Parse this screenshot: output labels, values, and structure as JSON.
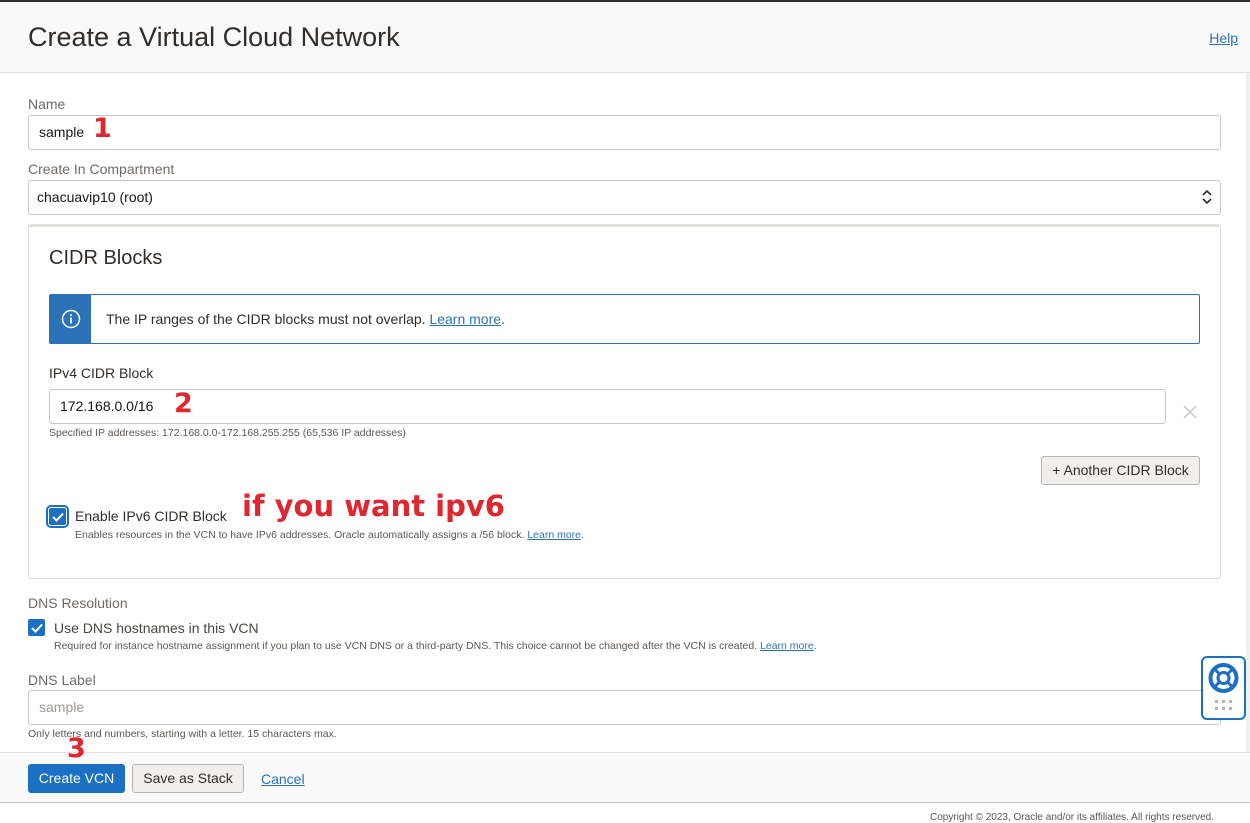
{
  "header": {
    "title": "Create a Virtual Cloud Network",
    "help": "Help"
  },
  "name_field": {
    "label": "Name",
    "value": "sample"
  },
  "compartment": {
    "label": "Create In Compartment",
    "selected": "chacuavip10 (root)"
  },
  "cidr": {
    "title": "CIDR Blocks",
    "info_text": "The IP ranges of the CIDR blocks must not overlap.",
    "info_link": "Learn more",
    "ipv4_label": "IPv4 CIDR Block",
    "ipv4_value": "172.168.0.0/16",
    "ipv4_hint": "Specified IP addresses: 172.168.0.0-172.168.255.255 (65,536 IP addresses)",
    "add_button": "+ Another CIDR Block",
    "ipv6_label": "Enable IPv6 CIDR Block",
    "ipv6_checked": true,
    "ipv6_hint": "Enables resources in the VCN to have IPv6 addresses. Oracle automatically assigns a /56 block.",
    "ipv6_link": "Learn more"
  },
  "dns": {
    "section_label": "DNS Resolution",
    "checkbox_label": "Use DNS hostnames in this VCN",
    "checked": true,
    "hint": "Required for instance hostname assignment if you plan to use VCN DNS or a third-party DNS. This choice cannot be changed after the VCN is created.",
    "hint_link": "Learn more",
    "dns_label": "DNS Label",
    "dns_placeholder": "sample",
    "dns_hint": "Only letters and numbers, starting with a letter. 15 characters max."
  },
  "footer": {
    "create": "Create VCN",
    "save_stack": "Save as Stack",
    "cancel": "Cancel",
    "copyright": "Copyright © 2023, Oracle and/or its affiliates. All rights reserved."
  },
  "annotations": {
    "n1": "1",
    "n2": "2",
    "n3": "3",
    "ipv6_note": "if you want ipv6"
  },
  "colors": {
    "accent": "#1c70c4",
    "annotation": "#e0262e",
    "link": "#2d72b8"
  }
}
